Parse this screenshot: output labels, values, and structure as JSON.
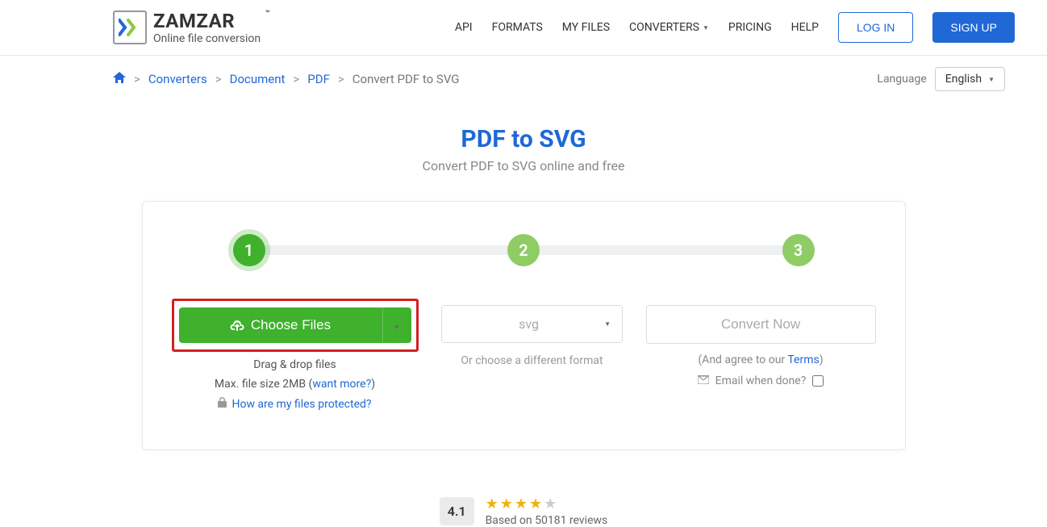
{
  "header": {
    "logo_name": "ZAMZAR",
    "logo_tm": "™",
    "logo_sub": "Online file conversion",
    "nav": {
      "api": "API",
      "formats": "FORMATS",
      "my_files": "MY FILES",
      "converters": "CONVERTERS",
      "pricing": "PRICING",
      "help": "HELP"
    },
    "login": "LOG IN",
    "signup": "SIGN UP"
  },
  "breadcrumb": {
    "converters": "Converters",
    "document": "Document",
    "pdf": "PDF",
    "current": "Convert PDF to SVG"
  },
  "language": {
    "label": "Language",
    "selected": "English"
  },
  "title": {
    "main": "PDF to SVG",
    "sub": "Convert PDF to SVG online and free"
  },
  "steps": {
    "s1": "1",
    "s2": "2",
    "s3": "3"
  },
  "step1": {
    "button": "Choose Files",
    "hint_drag": "Drag & drop files",
    "hint_max_pre": "Max. file size 2MB (",
    "hint_max_link": "want more?",
    "hint_max_post": ")",
    "hint_protect": "How are my files protected?"
  },
  "step2": {
    "selected": "svg",
    "hint": "Or choose a different format"
  },
  "step3": {
    "button": "Convert Now",
    "agree_pre": "(And agree to our ",
    "agree_link": "Terms",
    "agree_post": ")",
    "email_label": "Email when done?"
  },
  "rating": {
    "score": "4.1",
    "sub": "Based on 50181 reviews"
  }
}
